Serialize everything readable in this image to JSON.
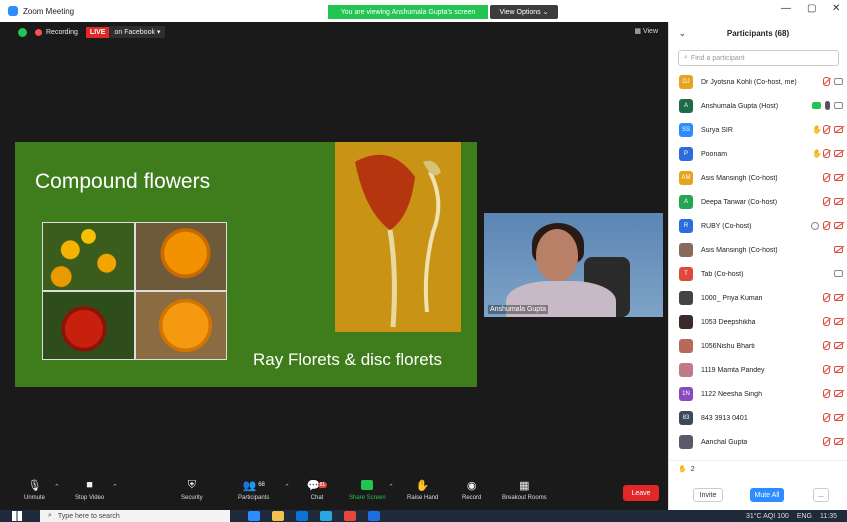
{
  "titlebar": {
    "title": "Zoom Meeting",
    "banner": "You are viewing Anshumala Gupta's screen",
    "view_options": "View Options ⌄",
    "minimize": "—",
    "restore": "▢",
    "close": "✕"
  },
  "meeting": {
    "recording": "Recording",
    "live": "LIVE",
    "live_target": "on Facebook ▾",
    "view": "▦ View"
  },
  "slide": {
    "title": "Compound flowers",
    "subtitle": "Ray Florets & disc florets"
  },
  "video": {
    "speaker_name": "Anshumala Gupta"
  },
  "toolbar": {
    "unmute": "Unmute",
    "stop_video": "Stop Video",
    "security": "Security",
    "participants": "Participants",
    "participants_count": "68",
    "chat": "Chat",
    "chat_badge": "81",
    "share_screen": "Share Screen",
    "raise_hand": "Raise Hand",
    "record": "Record",
    "breakout": "Breakout Rooms",
    "leave": "Leave"
  },
  "panel": {
    "title": "Participants (68)",
    "search_placeholder": "Find a participant",
    "participants": [
      {
        "initials": "DJ",
        "color": "#e8a21c",
        "name": "Dr Jyotsna Kohli (Co-host, me)",
        "icons": [
          "mic-off",
          "cam-on"
        ]
      },
      {
        "initials": "A",
        "color": "#1e6b45",
        "name": "Anshumala Gupta (Host)",
        "icons": [
          "share",
          "mic-on",
          "cam-on"
        ]
      },
      {
        "initials": "SS",
        "color": "#2d8cff",
        "name": "Surya SIR",
        "icons": [
          "hand",
          "mic-off",
          "cam-off"
        ]
      },
      {
        "initials": "P",
        "color": "#2d6cdf",
        "name": "Poonam",
        "icons": [
          "hand",
          "mic-off",
          "cam-off"
        ]
      },
      {
        "initials": "AM",
        "color": "#e8a21c",
        "name": "Asis Mansingh (Co-host)",
        "icons": [
          "mic-off",
          "cam-off"
        ]
      },
      {
        "initials": "A",
        "color": "#23a552",
        "name": "Deepa Tanwar (Co-host)",
        "icons": [
          "mic-off",
          "cam-off"
        ]
      },
      {
        "initials": "R",
        "color": "#2d6cdf",
        "name": "RUBY (Co-host)",
        "icons": [
          "spot",
          "mic-off",
          "cam-off"
        ]
      },
      {
        "initials": "",
        "color": "#8a6a5a",
        "name": "Asis Mansingh (Co-host)",
        "icons": [
          "cam-off"
        ]
      },
      {
        "initials": "T",
        "color": "#e0483c",
        "name": "Tab (Co-host)",
        "icons": [
          "cam-on"
        ]
      },
      {
        "initials": "",
        "color": "#444444",
        "name": "1000_ Priya Kumari",
        "icons": [
          "mic-off",
          "cam-off"
        ]
      },
      {
        "initials": "",
        "color": "#3a2a2a",
        "name": "1053 Deepshikha",
        "icons": [
          "mic-off",
          "cam-off"
        ]
      },
      {
        "initials": "",
        "color": "#b86a5a",
        "name": "1056Nishu Bharti",
        "icons": [
          "mic-off",
          "cam-off"
        ]
      },
      {
        "initials": "",
        "color": "#c07a8a",
        "name": "1119 Mamta Pandey",
        "icons": [
          "mic-off",
          "cam-off"
        ]
      },
      {
        "initials": "1N",
        "color": "#8a4abf",
        "name": "1122 Neesha Singh",
        "icons": [
          "mic-off",
          "cam-off"
        ]
      },
      {
        "initials": "83",
        "color": "#3a4a5a",
        "name": "843 3913 0401",
        "icons": [
          "mic-off",
          "cam-off"
        ]
      },
      {
        "initials": "",
        "color": "#5a5a6a",
        "name": "Aanchal Gupta",
        "icons": [
          "mic-off",
          "cam-off"
        ]
      }
    ],
    "raise_hand_count": "2",
    "invite": "Invite",
    "mute_all": "Mute All",
    "more": "..."
  },
  "taskbar": {
    "search_placeholder": "Type here to search",
    "weather": "31°C AQI 100",
    "language": "ENG",
    "time": "11:35"
  }
}
